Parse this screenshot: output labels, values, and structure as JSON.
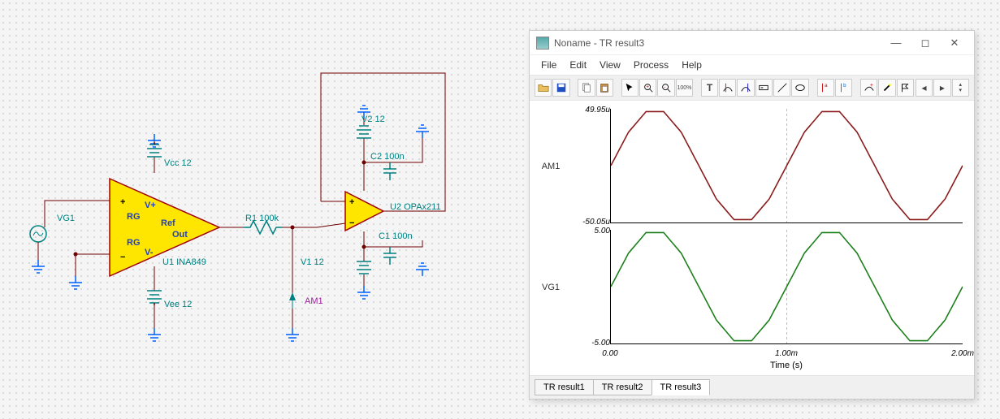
{
  "schematic": {
    "sources": {
      "VG1": "VG1"
    },
    "amps": {
      "U1": {
        "ref": "U1 INA849",
        "pins": {
          "vp": "V+",
          "vm": "V-",
          "rg1": "RG",
          "rg2": "RG",
          "ref": "Ref",
          "out": "Out"
        }
      },
      "U2": {
        "ref": "U2 OPAx211"
      }
    },
    "supplies": {
      "Vcc": "Vcc 12",
      "Vee": "Vee 12",
      "V1": "V1 12",
      "V2": "V2 12"
    },
    "passives": {
      "R1": "R1 100k",
      "C1": "C1 100n",
      "C2": "C2 100n"
    },
    "probes": {
      "AM1": "AM1"
    }
  },
  "dialog": {
    "title": "Noname - TR result3",
    "menu": [
      "File",
      "Edit",
      "View",
      "Process",
      "Help"
    ],
    "xaxis": {
      "label": "Time (s)",
      "ticks": [
        "0.00",
        "1.00m",
        "2.00m"
      ]
    },
    "tabs": [
      "TR result1",
      "TR result2",
      "TR result3"
    ],
    "active_tab": 2
  },
  "chart_data": [
    {
      "type": "line",
      "name": "AM1",
      "color": "#8b1a1a",
      "ylim": [
        -5.005e-05,
        4.995e-05
      ],
      "ylabels": [
        "49.95u",
        "-50.05u"
      ],
      "xlim": [
        0,
        0.002
      ],
      "x": [
        0,
        0.0001,
        0.0002,
        0.0003,
        0.0004,
        0.0005,
        0.0006,
        0.0007,
        0.0008,
        0.0009,
        0.001,
        0.0011,
        0.0012,
        0.0013,
        0.0014,
        0.0015,
        0.0016,
        0.0017,
        0.0018,
        0.0019,
        0.002
      ],
      "values": [
        0,
        2.94e-05,
        4.75e-05,
        4.75e-05,
        2.94e-05,
        0,
        -2.94e-05,
        -4.75e-05,
        -4.75e-05,
        -2.94e-05,
        0,
        2.94e-05,
        4.75e-05,
        4.75e-05,
        2.94e-05,
        0,
        -2.94e-05,
        -4.75e-05,
        -4.75e-05,
        -2.94e-05,
        0
      ]
    },
    {
      "type": "line",
      "name": "VG1",
      "color": "#1a7f1a",
      "ylim": [
        -5.0,
        5.0
      ],
      "ylabels": [
        "5.00",
        "-5.00"
      ],
      "xlim": [
        0,
        0.002
      ],
      "x": [
        0,
        0.0001,
        0.0002,
        0.0003,
        0.0004,
        0.0005,
        0.0006,
        0.0007,
        0.0008,
        0.0009,
        0.001,
        0.0011,
        0.0012,
        0.0013,
        0.0014,
        0.0015,
        0.0016,
        0.0017,
        0.0018,
        0.0019,
        0.002
      ],
      "values": [
        0,
        2.94,
        4.76,
        4.76,
        2.94,
        0,
        -2.94,
        -4.76,
        -4.76,
        -2.94,
        0,
        2.94,
        4.76,
        4.76,
        2.94,
        0,
        -2.94,
        -4.76,
        -4.76,
        -2.94,
        0
      ]
    }
  ]
}
